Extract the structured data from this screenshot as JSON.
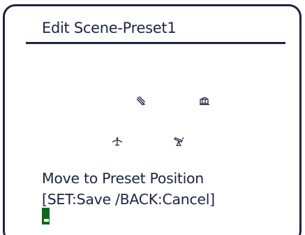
{
  "dialog": {
    "title": "Edit Scene-Preset1",
    "message_line1": "Move to Preset Position",
    "message_line2": "[SET:Save /BACK:Cancel]"
  },
  "icons": [
    "pen-icon",
    "camera-icon",
    "drone-icon",
    "telescope-icon"
  ],
  "colors": {
    "text": "#1c2541",
    "cursor": "#0b6b1a",
    "background": "#ffffff"
  }
}
